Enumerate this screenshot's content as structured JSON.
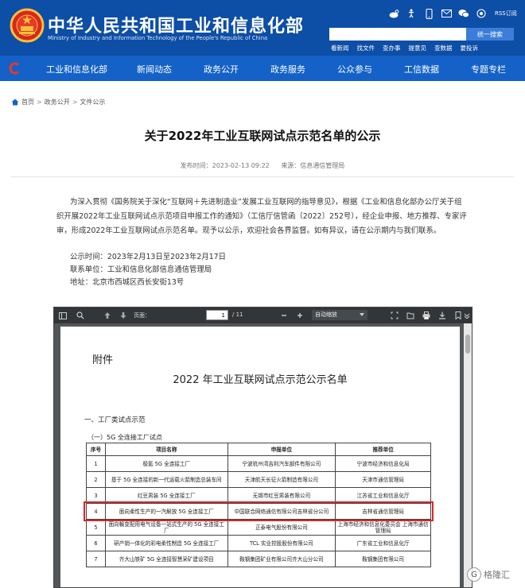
{
  "site": {
    "title": "中华人民共和国工业和信息化部",
    "subtitle": "Ministry of Industry and Information Technology of the People's Republic of China",
    "rss": "RSS订阅",
    "search_button": "统一搜索",
    "quick_links": [
      "看新闻",
      "找文件",
      "查办事",
      "提意见",
      "查数据",
      "要投诉"
    ],
    "nav": [
      "工业和信息化部",
      "新闻动态",
      "政务公开",
      "政务服务",
      "公众参与",
      "工信数据",
      "专题专栏"
    ]
  },
  "breadcrumb": [
    "首页",
    "政务公开",
    "文件公示"
  ],
  "article": {
    "title": "关于2022年工业互联网试点示范名单的公示",
    "publish_time": "发布时间：2023-02-13 09:22",
    "source": "来源：信息通信管理局",
    "body_lines": [
      "为深入贯彻《国务院关于深化“互联网＋先进制造业”发展工业互联网的指导意见》，根据《工业和信息化部办公厅关于组",
      "织开展2022年工业互联网试点示范项目申报工作的通知》（工信厅信管函〔2022〕252号），经企业申报、地方推荐、专家评",
      "审，形成2022年工业互联网试点示范名单。现予以公示，欢迎社会各界监督。如有异议，请在公示期内与我们联系。"
    ],
    "info_lines": [
      "公示时间：2023年2月13日至2023年2月17日",
      "联系单位：工业和信息化部信息通信管理局",
      "地址：北京市西城区西长安街13号"
    ]
  },
  "pdf": {
    "page_label": "页面：",
    "page_current": "1",
    "page_total": "/ 11",
    "zoom": "自动缩放",
    "attachment": "附件",
    "doc_title": "2022 年工业互联网试点示范公示名单",
    "section1": "一、工厂类试点示范",
    "section2": "（一）5G 全连接工厂试点",
    "headers": [
      "序号",
      "项目名称",
      "申报单位",
      "推荐单位"
    ],
    "rows": [
      [
        "1",
        "极氪 5G 全连接工厂",
        "宁波杭州湾吉利汽车部件有限公司",
        "宁波市经济和信息化局"
      ],
      [
        "2",
        "基于 5G 全连接的新一代运载火箭制造总装车间",
        "天津航天长征火箭制造有限公司",
        "天津市通信管理局"
      ],
      [
        "3",
        "红豆男装 5G 全连接工厂",
        "无锡市红豆男装有限公司",
        "江苏省工业和信息化厅"
      ],
      [
        "4",
        "面向柔性生产的一汽解放 5G 全连接工厂",
        "中国联合网络通信有限公司吉林省分公司",
        "吉林省通信管理局"
      ],
      [
        "5",
        "面向輸变配用电气设备一站式生产的 5G 全连接工厂",
        "正泰电气股份有限公司",
        "上海市经济和信息化委员会 上海市通信管理局"
      ],
      [
        "6",
        "研产销一体化的彩电柔性制造 5G 全连接工厂",
        "TCL 实业控股股份有限公司",
        "广东省工业和信息化厅"
      ],
      [
        "7",
        "齐大山铁矿 5G 全连接智慧采矿建设项目",
        "鞍钢集团矿业有限公司齐大山分公司",
        "鞍钢集团有限公司"
      ]
    ]
  },
  "watermark": "格隆汇",
  "colors": {
    "header": "#0d4ea6",
    "nav": "#1462c7",
    "highlight": "#d7262a"
  }
}
